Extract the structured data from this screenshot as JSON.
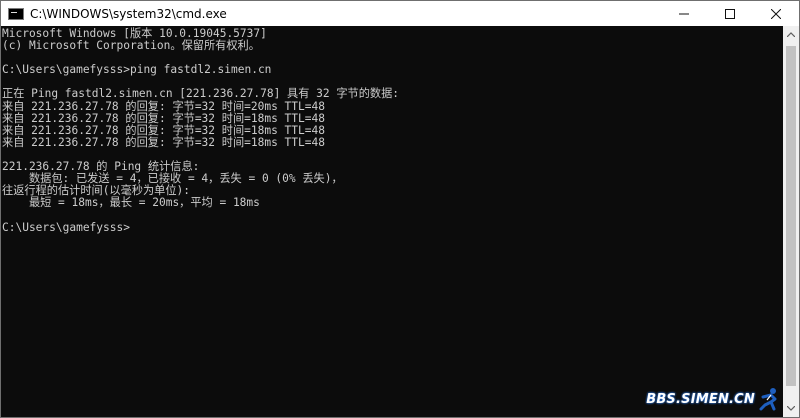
{
  "titlebar": {
    "title": "C:\\WINDOWS\\system32\\cmd.exe",
    "icon": "console-app-icon",
    "controls": [
      "minimize-icon",
      "maximize-icon",
      "close-icon"
    ]
  },
  "console": {
    "lines": [
      "Microsoft Windows [版本 10.0.19045.5737]",
      "(c) Microsoft Corporation。保留所有权利。",
      "",
      "C:\\Users\\gamefysss>ping fastdl2.simen.cn",
      "",
      "正在 Ping fastdl2.simen.cn [221.236.27.78] 具有 32 字节的数据:",
      "来自 221.236.27.78 的回复: 字节=32 时间=20ms TTL=48",
      "来自 221.236.27.78 的回复: 字节=32 时间=18ms TTL=48",
      "来自 221.236.27.78 的回复: 字节=32 时间=18ms TTL=48",
      "来自 221.236.27.78 的回复: 字节=32 时间=18ms TTL=48",
      "",
      "221.236.27.78 的 Ping 统计信息:",
      "    数据包: 已发送 = 4，已接收 = 4，丢失 = 0 (0% 丢失)，",
      "往返行程的估计时间(以毫秒为单位):",
      "    最短 = 18ms，最长 = 20ms，平均 = 18ms",
      "",
      "C:\\Users\\gamefysss>"
    ],
    "text_color": "#cccccc",
    "background": "#0c0c0c"
  },
  "watermark": {
    "text": "BBS.SIMEN.CN",
    "color": "#ffffff",
    "glow": "#2a6fd0"
  }
}
